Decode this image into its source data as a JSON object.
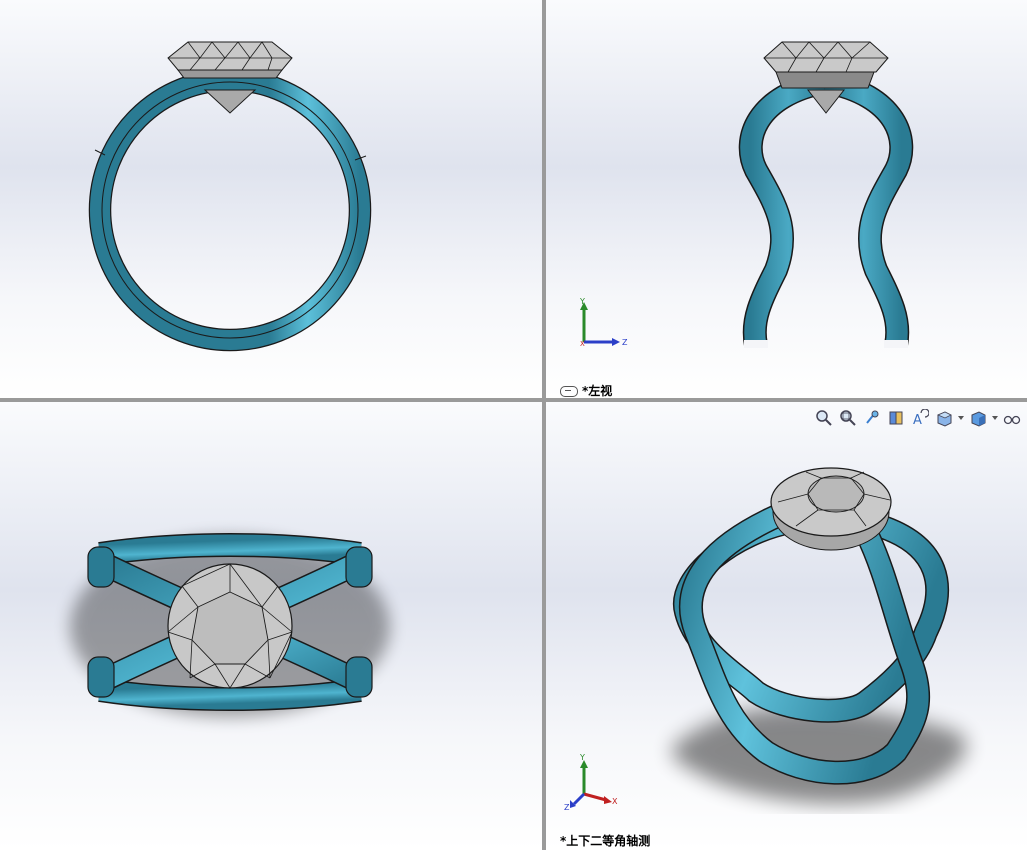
{
  "viewports": {
    "front": {
      "label": ""
    },
    "left": {
      "label": "*左视"
    },
    "top": {
      "label": ""
    },
    "iso": {
      "label": "*上下二等角轴测"
    }
  },
  "triad": {
    "x": "X",
    "y": "Y",
    "z": "Z"
  },
  "heads_up_toolbar": {
    "icons": [
      "zoom-to-fit-icon",
      "zoom-to-area-icon",
      "previous-view-icon",
      "section-view-icon",
      "dynamic-annotation-view-icon",
      "view-orientation-icon",
      "display-style-icon",
      "hide-show-items-icon"
    ]
  },
  "colors": {
    "band": "#2a7b93",
    "band_highlight": "#4fb0cc",
    "gem": "#bdbdbd",
    "edge": "#1a1a1a",
    "background_top": "#fafbfd",
    "background_mid": "#dfe3ee"
  }
}
